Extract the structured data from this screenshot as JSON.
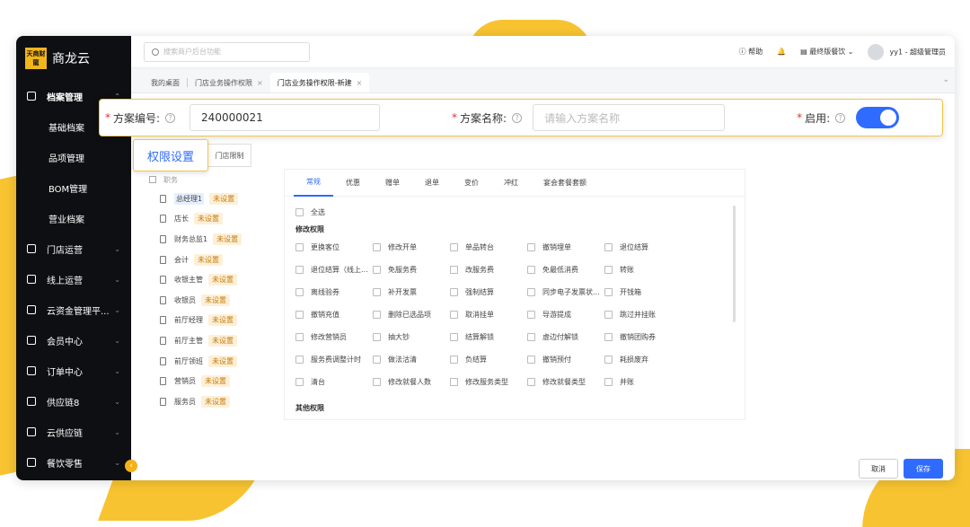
{
  "app": {
    "logo_mark": "天商财龍",
    "logo_text": "商龙云"
  },
  "sidebar": {
    "items": [
      {
        "label": "档案管理",
        "icon": "archive-icon",
        "expanded": true
      },
      {
        "label": "基础档案"
      },
      {
        "label": "品项管理"
      },
      {
        "label": "BOM管理"
      },
      {
        "label": "营业档案"
      },
      {
        "label": "门店运营",
        "icon": "store-icon"
      },
      {
        "label": "线上运营",
        "icon": "online-icon"
      },
      {
        "label": "云资金管理平...",
        "icon": "fund-icon"
      },
      {
        "label": "会员中心",
        "icon": "member-icon"
      },
      {
        "label": "订单中心",
        "icon": "order-icon"
      },
      {
        "label": "供应链8",
        "icon": "supply-icon"
      },
      {
        "label": "云供应链",
        "icon": "cloud-supply-icon"
      },
      {
        "label": "餐饮零售",
        "icon": "retail-icon"
      }
    ]
  },
  "header": {
    "search_placeholder": "搜索商户后台功能",
    "help": "帮助",
    "store": "最终版餐饮",
    "user": "yy1 - 超级管理员"
  },
  "tabs": [
    {
      "label": "我的桌面",
      "closable": false,
      "active": false
    },
    {
      "label": "门店业务操作权限",
      "closable": true,
      "active": false
    },
    {
      "label": "门店业务操作权限-新建",
      "closable": true,
      "active": true
    }
  ],
  "form": {
    "code_label": "方案编号:",
    "code_value": "240000021",
    "name_label": "方案名称:",
    "name_placeholder": "请输入方案名称",
    "enable_label": "启用:",
    "enabled": true
  },
  "subtabs": {
    "active": "权限设置",
    "other": "门店限制"
  },
  "tree": {
    "root": "职务",
    "nodes": [
      {
        "name": "总经理1",
        "badge": "未设置",
        "selected": true
      },
      {
        "name": "店长",
        "badge": "未设置"
      },
      {
        "name": "财务总监1",
        "badge": "未设置"
      },
      {
        "name": "会计",
        "badge": "未设置"
      },
      {
        "name": "收银主管",
        "badge": "未设置"
      },
      {
        "name": "收银员",
        "badge": "未设置"
      },
      {
        "name": "前厅经理",
        "badge": "未设置"
      },
      {
        "name": "前厅主管",
        "badge": "未设置"
      },
      {
        "name": "前厅领班",
        "badge": "未设置"
      },
      {
        "name": "营销员",
        "badge": "未设置"
      },
      {
        "name": "服务员",
        "badge": "未设置"
      }
    ]
  },
  "perm": {
    "tabs": [
      "常规",
      "优惠",
      "赠单",
      "退单",
      "变价",
      "冲红",
      "宴会套餐套额"
    ],
    "select_all": "全选",
    "section1": "修改权限",
    "rows": [
      [
        "更换客位",
        "修改开单",
        "单品转台",
        "撤销埋单",
        "退位结算"
      ],
      [
        "退位结算（线上...",
        "免服务费",
        "改服务费",
        "免最低消费",
        "转账"
      ],
      [
        "离线验券",
        "补开发票",
        "强制结算",
        "同步电子发票状...",
        "开钱箱"
      ],
      [
        "撤销充值",
        "删除已选品项",
        "取消挂单",
        "导游提成",
        "跳过并挂账"
      ],
      [
        "修改营销员",
        "抽大钞",
        "结算解锁",
        "虚边付解锁",
        "撤销团购券"
      ],
      [
        "服务费调整计时",
        "做法沽清",
        "负结算",
        "撤销预付",
        "耗损废弃"
      ],
      [
        "清台",
        "修改就餐人数",
        "修改服务类型",
        "修改就餐类型",
        "并账"
      ]
    ],
    "section2": "其他权限"
  },
  "footer": {
    "cancel": "取消",
    "save": "保存"
  },
  "colors": {
    "accent": "#2f6bff",
    "highlight_border": "#f5c542",
    "sidebar_bg": "#0e0f12"
  }
}
